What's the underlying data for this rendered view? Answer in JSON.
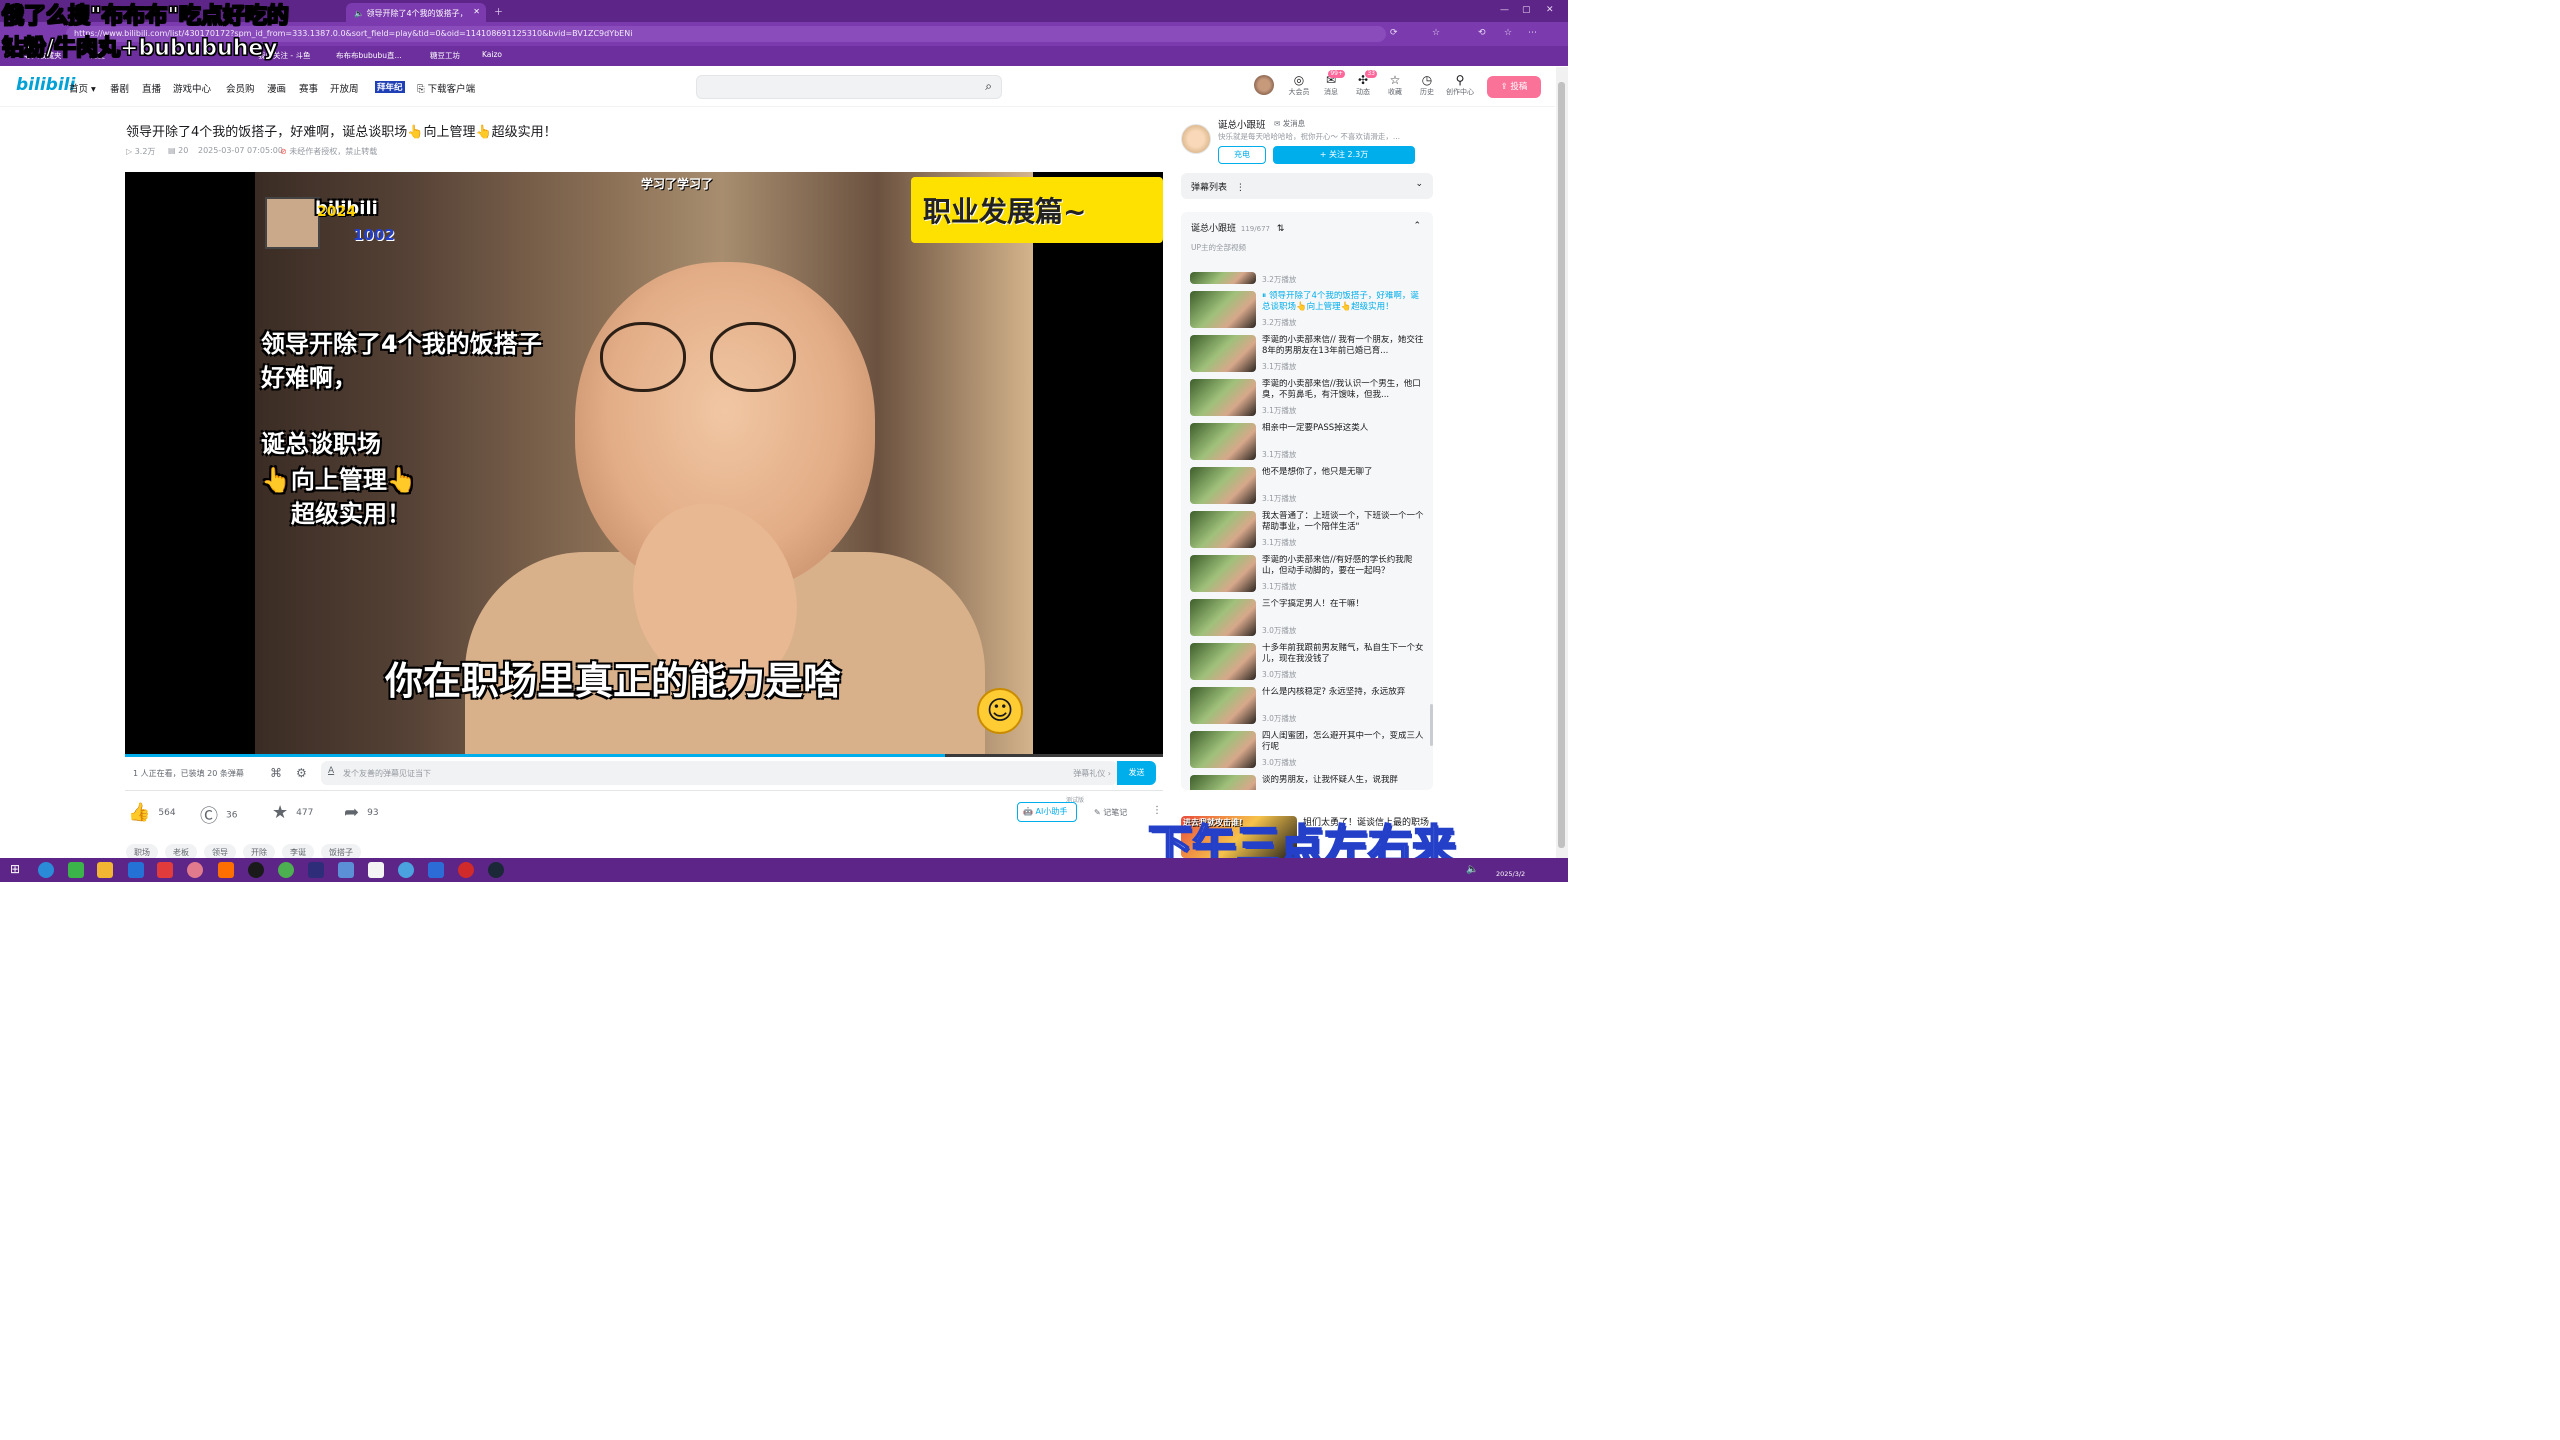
{
  "browser": {
    "tabs": [
      {
        "label": "领导开除了4个我的饭搭子，",
        "active": true
      }
    ],
    "url": "https://www.bilibili.com/list/430170172?spm_id_from=333.1387.0.0&sort_field=play&tid=0&oid=114108691125310&bvid=BV1ZC9dYbENi",
    "bookmarks": [
      "导入收藏夹",
      "百度",
      "我的关注 - 斗鱼",
      "布布布bububu直...",
      "糖豆工坊",
      "Kaizo"
    ]
  },
  "overlay": {
    "line1": "俄了么搜\"布布布\"吃点好吃的",
    "line2": "钻粉/牛肉丸+bububuhey",
    "bottom_right": "下午三点左右来"
  },
  "site": {
    "logo": "bilibili",
    "nav": [
      "首页",
      "番剧",
      "直播",
      "游戏中心",
      "会员购",
      "漫画",
      "赛事",
      "开放周",
      "拜年纪",
      "下载客户端"
    ],
    "right_icons": [
      {
        "label": "大会员",
        "icon": "vip-icon",
        "badge": ""
      },
      {
        "label": "消息",
        "icon": "message-icon",
        "badge": "99+"
      },
      {
        "label": "动态",
        "icon": "dynamic-icon",
        "badge": "33"
      },
      {
        "label": "收藏",
        "icon": "star-icon",
        "badge": ""
      },
      {
        "label": "历史",
        "icon": "history-icon",
        "badge": ""
      },
      {
        "label": "创作中心",
        "icon": "bulb-icon",
        "badge": ""
      }
    ],
    "upload_label": "投稿"
  },
  "video": {
    "title": "领导开除了4个我的饭搭子，好难啊，诞总谈职场👆向上管理👆超级实用！",
    "views": "3.2万",
    "danmaku_count": "20",
    "date": "2025-03-07 07:05:00",
    "copyright": "未经作者授权，禁止转载",
    "overlay_top": "学习了学习了",
    "overlay_badge": "职业发展篇~",
    "overlay_left": [
      "领导开除了4个我的饭搭子",
      "好难啊，",
      "诞总谈职场",
      "👆向上管理👆",
      "超级实用！"
    ],
    "subtitle": "你在职场里真正的能力是啥",
    "watermark": "bilibili",
    "year_tag": "2024",
    "num_tag": "1002",
    "progress": 0.79
  },
  "danmaku_bar": {
    "watching": "1 人正在看，已装填 20 条弹幕",
    "placeholder": "发个友善的弹幕见证当下",
    "etiquette": "弹幕礼仪 ›",
    "send": "发送"
  },
  "actions": {
    "like": "564",
    "coin": "36",
    "fav": "477",
    "share": "93",
    "ai_label": "AI小助手",
    "ai_badge": "测试版",
    "note": "记笔记"
  },
  "tags": [
    "职场",
    "老板",
    "领导",
    "开除",
    "李诞",
    "饭搭子"
  ],
  "up": {
    "name": "诞总小跟班",
    "message": "发消息",
    "desc": "快乐就是每天哈哈哈哈，祝你开心～ 不喜欢请滑走，...",
    "charge": "充电",
    "follow": "+ 关注 2.3万"
  },
  "danmaku_list": "弹幕列表",
  "series": {
    "title": "诞总小跟班",
    "count": "119/677",
    "subtitle": "UP主的全部视频",
    "items": [
      {
        "title": "",
        "plays": "3.2万播放",
        "current": false
      },
      {
        "title": "领导开除了4个我的饭搭子，好难啊，诞总谈职场👆向上管理👆超级实用！",
        "plays": "3.2万播放",
        "current": true
      },
      {
        "title": "李诞的小卖部来信// 我有一个朋友，她交往8年的男朋友在13年前已婚已育...",
        "plays": "3.1万播放",
        "current": false
      },
      {
        "title": "李诞的小卖部来信//我认识一个男生，他口臭，不剪鼻毛，有汗馊味，但我...",
        "plays": "3.1万播放",
        "current": false
      },
      {
        "title": "相亲中一定要PASS掉这类人",
        "plays": "3.1万播放",
        "current": false
      },
      {
        "title": "他不是想你了，他只是无聊了",
        "plays": "3.1万播放",
        "current": false
      },
      {
        "title": "我太普通了：上班谈一个，下班谈一个一个帮助事业，一个陪伴生活\"",
        "plays": "3.1万播放",
        "current": false
      },
      {
        "title": "李诞的小卖部来信//有好感的学长约我爬山，但动手动脚的，要在一起吗？",
        "plays": "3.1万播放",
        "current": false
      },
      {
        "title": "三个字搞定男人！在干嘛！",
        "plays": "3.0万播放",
        "current": false
      },
      {
        "title": "十多年前我跟前男友赌气，私自生下一个女儿，现在我没钱了",
        "plays": "3.0万播放",
        "current": false
      },
      {
        "title": "什么是内核稳定? 永远坚持，永远放弃",
        "plays": "3.0万播放",
        "current": false
      },
      {
        "title": "四人闺蜜团，怎么避开其中一个，变成三人行呢",
        "plays": "3.0万播放",
        "current": false
      },
      {
        "title": "谈的男朋友，让我怀疑人生，说我胖",
        "plays": "",
        "current": false
      }
    ]
  },
  "bottom_promo": {
    "tag": "进去我就攻击谁!",
    "text": "姐们太勇了！诞谈信上最的职场"
  },
  "taskbar": {
    "date": "2025/3/2"
  }
}
